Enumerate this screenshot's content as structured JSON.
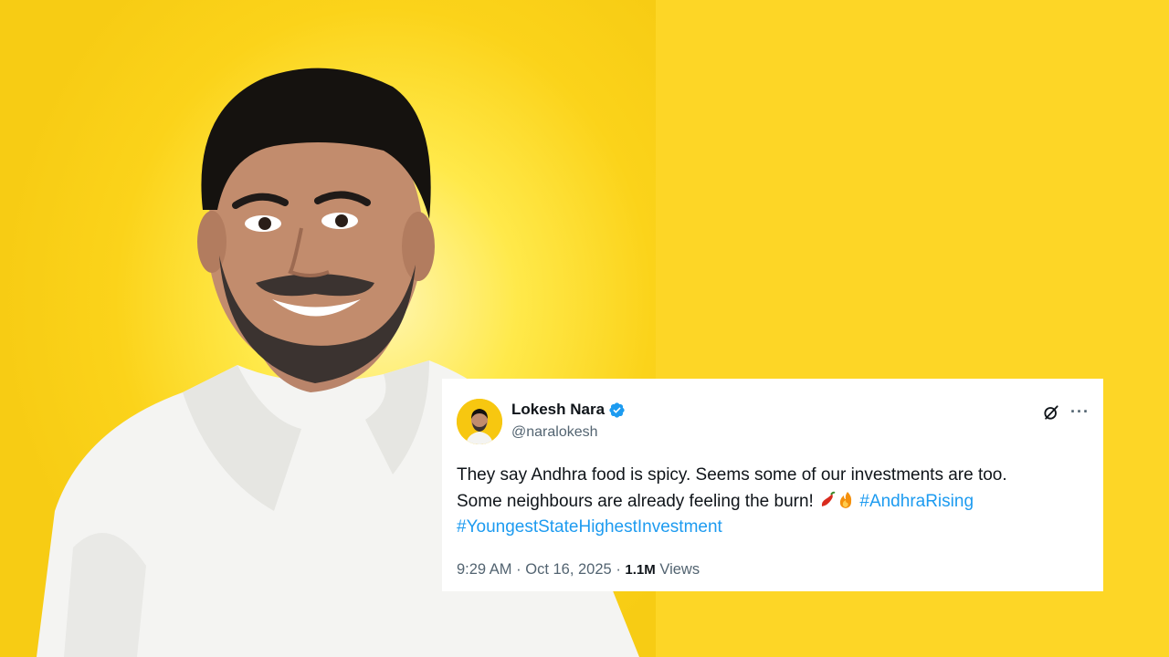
{
  "tweet": {
    "display_name": "Lokesh Nara",
    "handle": "@naralokesh",
    "text_line1": "They say Andhra food is spicy. Seems some of our investments are too.",
    "text_line2_prefix": "Some neighbours are already feeling the burn!",
    "hashtag1": "#AndhraRising",
    "hashtag2": "#YoungestStateHighestInvestment",
    "time": "9:29 AM",
    "date": "Oct 16, 2025",
    "separator": "·",
    "views_count": "1.1M",
    "views_label": "Views",
    "emojis": [
      "chili-pepper",
      "fire"
    ]
  },
  "colors": {
    "background_yellow": "#fdd626",
    "hashtag_blue": "#1d9bf0",
    "verified_blue": "#1d9bf0"
  },
  "icons": [
    "verified-badge-icon",
    "grok-icon",
    "more-options-icon"
  ]
}
